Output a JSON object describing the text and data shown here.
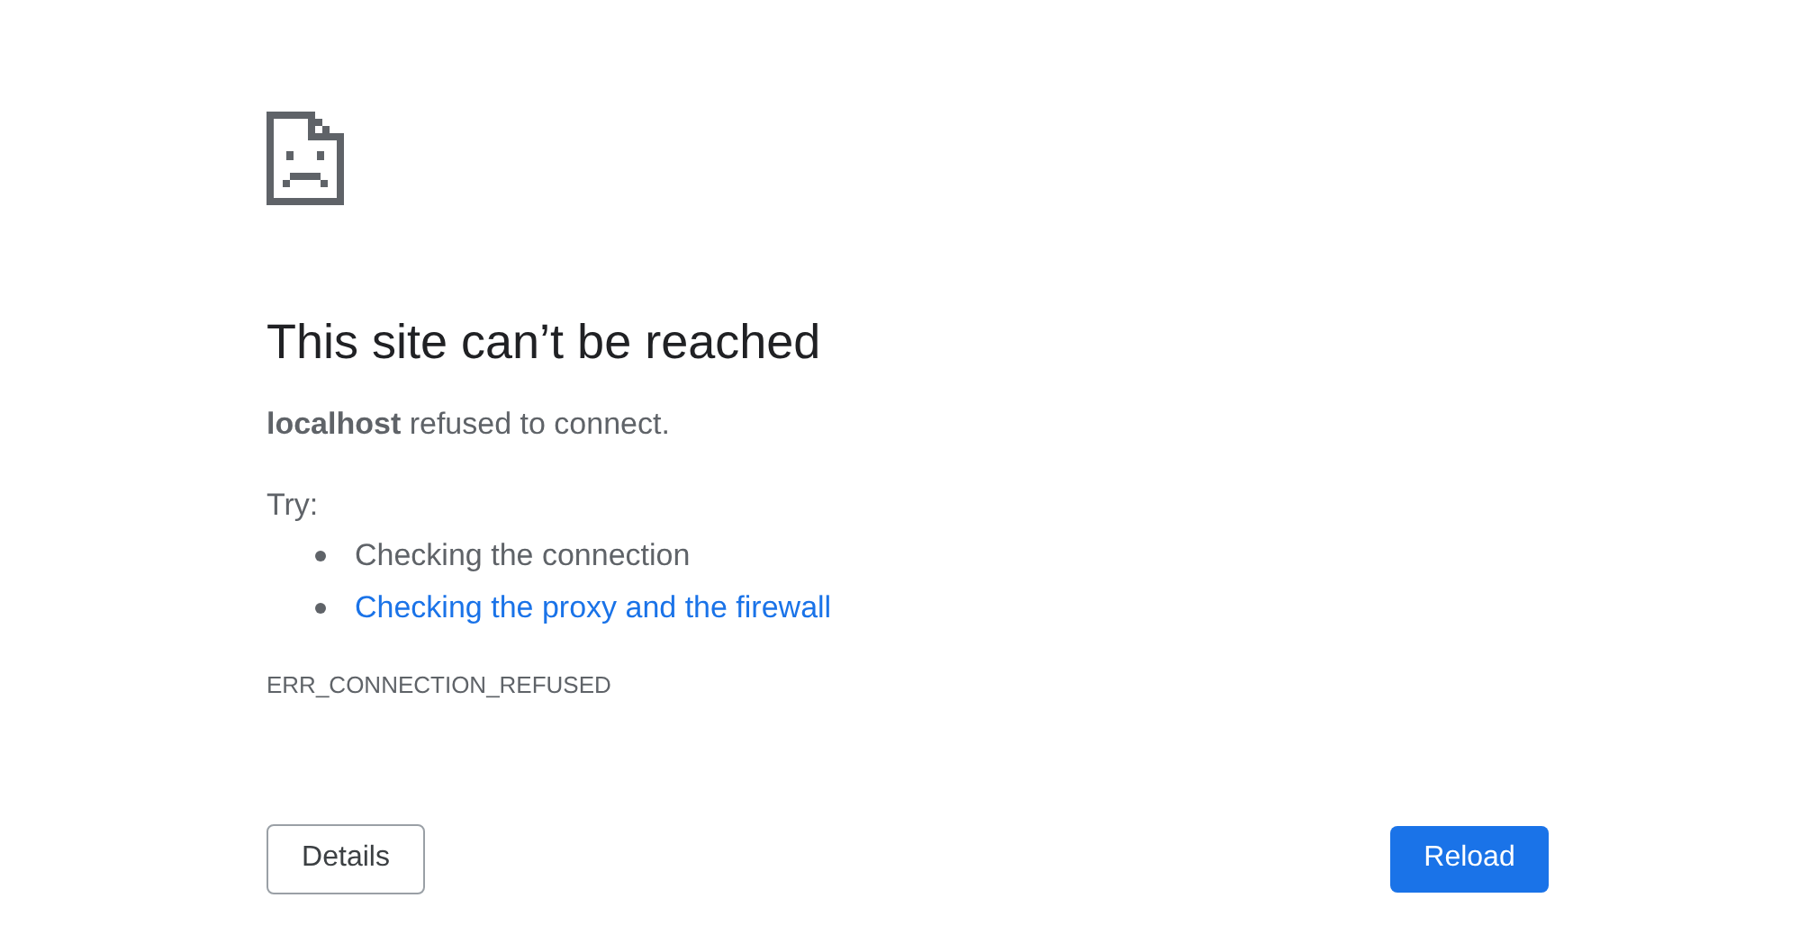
{
  "title": "This site can’t be reached",
  "message": "**localhost** refused to connect.",
  "try_label": "Try:",
  "suggestions": [
    {
      "text": "Checking the connection",
      "kind": "plain"
    },
    {
      "text": "Checking the proxy and the firewall",
      "kind": "link"
    }
  ],
  "error_code": "ERR_CONNECTION_REFUSED",
  "details_button": "Details",
  "reload_button": "Reload"
}
